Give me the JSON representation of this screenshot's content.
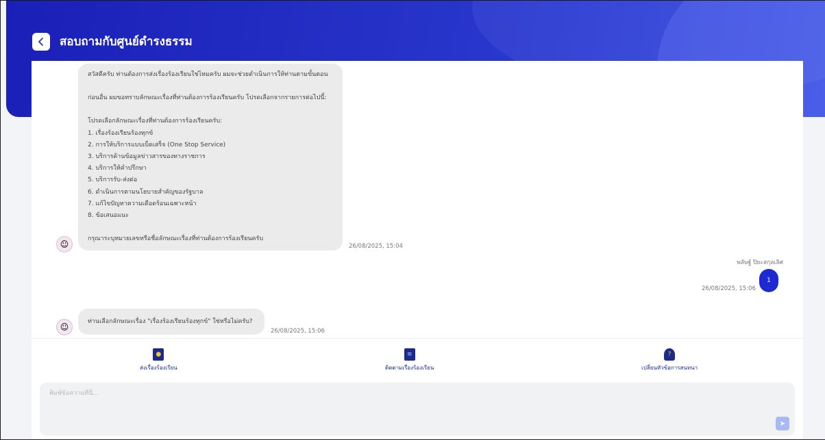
{
  "header": {
    "back_icon": "chevron-left-icon",
    "title": "สอบถามกับศูนย์ดำรงธรรม"
  },
  "messages": {
    "bot1": {
      "lines": [
        "สวัสดีครับ ท่านต้องการส่งเรื่องร้องเรียนใช่ไหมครับ ผมจะช่วยดำเนินการให้ท่านตามขั้นตอน",
        "",
        "ก่อนอื่น ผมขอทราบลักษณะเรื่องที่ท่านต้องการร้องเรียนครับ โปรดเลือกจากรายการต่อไปนี้:",
        "",
        "โปรดเลือกลักษณะเรื่องที่ท่านต้องการร้องเรียนครับ:",
        "1. เรื่องร้องเรียนร้องทุกข์",
        "2. การให้บริการแบบเบ็ดเสร็จ (One Stop Service)",
        "3. บริการด้านข้อมูลข่าวสารของทางราชการ",
        "4. บริการให้คำปรึกษา",
        "5. บริการรับ-ส่งต่อ",
        "6. ดำเนินการตามนโยบายสำคัญของรัฐบาล",
        "7. แก้ไขปัญหาความเดือดร้อนเฉพาะหน้า",
        "8. ข้อเสนอแนะ",
        "",
        "กรุณาระบุหมายเลขหรือชื่อลักษณะเรื่องที่ท่านต้องการร้องเรียนครับ"
      ],
      "timestamp": "26/08/2025, 15:04"
    },
    "user1": {
      "name": "พลัษฐ์ ปิยะสกุลเลิศ",
      "text": "1",
      "timestamp": "26/08/2025, 15:06"
    },
    "bot2": {
      "text": "ท่านเลือกลักษณะเรื่อง \"เรื่องร้องเรียนร้องทุกข์\" ใช่หรือไม่ครับ?",
      "timestamp": "26/08/2025, 15:06"
    }
  },
  "toolbar": {
    "submit_label": "ส่งเรื่องร้องเรียน",
    "track_label": "ติดตามเรื่องร้องเรียน",
    "change_label": "เปลี่ยนหัวข้อการสนทนา"
  },
  "input": {
    "placeholder": "พิมพ์ข้อความที่นี่..."
  },
  "colors": {
    "header_bg": "#2531c6",
    "user_bubble": "#1d2ad0",
    "bot_bubble": "#ebebeb",
    "icon_navy": "#1d2a8c",
    "send_button": "#aab8f3"
  }
}
